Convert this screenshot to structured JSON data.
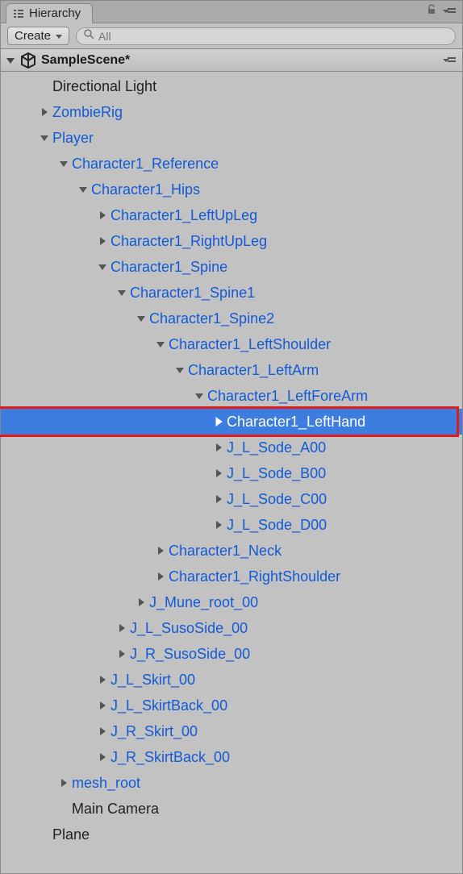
{
  "panel": {
    "title": "Hierarchy"
  },
  "toolbar": {
    "create_label": "Create",
    "search_placeholder": "All"
  },
  "scene": {
    "title": "SampleScene*"
  },
  "tree": [
    {
      "depth": 0,
      "arrow": "none",
      "label": "Directional Light",
      "prefab": false
    },
    {
      "depth": 0,
      "arrow": "right",
      "label": "ZombieRig",
      "prefab": true
    },
    {
      "depth": 0,
      "arrow": "down",
      "label": "Player",
      "prefab": true
    },
    {
      "depth": 1,
      "arrow": "down",
      "label": "Character1_Reference",
      "prefab": true
    },
    {
      "depth": 2,
      "arrow": "down",
      "label": "Character1_Hips",
      "prefab": true
    },
    {
      "depth": 3,
      "arrow": "right",
      "label": "Character1_LeftUpLeg",
      "prefab": true
    },
    {
      "depth": 3,
      "arrow": "right",
      "label": "Character1_RightUpLeg",
      "prefab": true
    },
    {
      "depth": 3,
      "arrow": "down",
      "label": "Character1_Spine",
      "prefab": true
    },
    {
      "depth": 4,
      "arrow": "down",
      "label": "Character1_Spine1",
      "prefab": true
    },
    {
      "depth": 5,
      "arrow": "down",
      "label": "Character1_Spine2",
      "prefab": true
    },
    {
      "depth": 6,
      "arrow": "down",
      "label": "Character1_LeftShoulder",
      "prefab": true
    },
    {
      "depth": 7,
      "arrow": "down",
      "label": "Character1_LeftArm",
      "prefab": true
    },
    {
      "depth": 8,
      "arrow": "down",
      "label": "Character1_LeftForeArm",
      "prefab": true
    },
    {
      "depth": 9,
      "arrow": "right",
      "label": "Character1_LeftHand",
      "prefab": true,
      "selected": true,
      "highlight": true
    },
    {
      "depth": 9,
      "arrow": "right",
      "label": "J_L_Sode_A00",
      "prefab": true
    },
    {
      "depth": 9,
      "arrow": "right",
      "label": "J_L_Sode_B00",
      "prefab": true
    },
    {
      "depth": 9,
      "arrow": "right",
      "label": "J_L_Sode_C00",
      "prefab": true
    },
    {
      "depth": 9,
      "arrow": "right",
      "label": "J_L_Sode_D00",
      "prefab": true
    },
    {
      "depth": 6,
      "arrow": "right",
      "label": "Character1_Neck",
      "prefab": true
    },
    {
      "depth": 6,
      "arrow": "right",
      "label": "Character1_RightShoulder",
      "prefab": true
    },
    {
      "depth": 5,
      "arrow": "right",
      "label": "J_Mune_root_00",
      "prefab": true
    },
    {
      "depth": 4,
      "arrow": "right",
      "label": "J_L_SusoSide_00",
      "prefab": true
    },
    {
      "depth": 4,
      "arrow": "right",
      "label": "J_R_SusoSide_00",
      "prefab": true
    },
    {
      "depth": 3,
      "arrow": "right",
      "label": "J_L_Skirt_00",
      "prefab": true
    },
    {
      "depth": 3,
      "arrow": "right",
      "label": "J_L_SkirtBack_00",
      "prefab": true
    },
    {
      "depth": 3,
      "arrow": "right",
      "label": "J_R_Skirt_00",
      "prefab": true
    },
    {
      "depth": 3,
      "arrow": "right",
      "label": "J_R_SkirtBack_00",
      "prefab": true
    },
    {
      "depth": 1,
      "arrow": "right",
      "label": "mesh_root",
      "prefab": true
    },
    {
      "depth": 1,
      "arrow": "none",
      "label": "Main Camera",
      "prefab": false
    },
    {
      "depth": 0,
      "arrow": "none",
      "label": "Plane",
      "prefab": false
    }
  ]
}
